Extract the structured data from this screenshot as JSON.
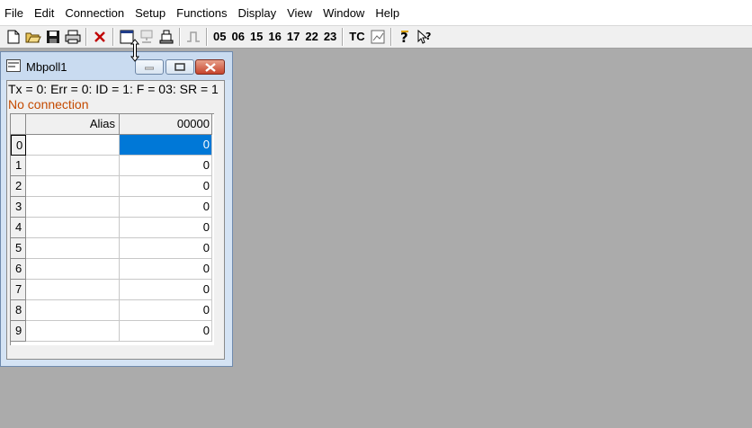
{
  "menu": [
    "File",
    "Edit",
    "Connection",
    "Setup",
    "Functions",
    "Display",
    "View",
    "Window",
    "Help"
  ],
  "toolbar": {
    "function_codes": [
      "05",
      "06",
      "15",
      "16",
      "17",
      "22",
      "23"
    ],
    "tc_label": "TC"
  },
  "window": {
    "title": "Mbpoll1",
    "status_line": "Tx = 0: Err = 0: ID = 1: F = 03: SR = 1",
    "connection_status": "No connection",
    "columns": {
      "alias": "Alias",
      "value": "00000"
    },
    "rows": [
      {
        "index": "0",
        "alias": "",
        "value": "0"
      },
      {
        "index": "1",
        "alias": "",
        "value": "0"
      },
      {
        "index": "2",
        "alias": "",
        "value": "0"
      },
      {
        "index": "3",
        "alias": "",
        "value": "0"
      },
      {
        "index": "4",
        "alias": "",
        "value": "0"
      },
      {
        "index": "5",
        "alias": "",
        "value": "0"
      },
      {
        "index": "6",
        "alias": "",
        "value": "0"
      },
      {
        "index": "7",
        "alias": "",
        "value": "0"
      },
      {
        "index": "8",
        "alias": "",
        "value": "0"
      },
      {
        "index": "9",
        "alias": "",
        "value": "0"
      }
    ]
  },
  "colors": {
    "selection": "#0078d7",
    "no_connection": "#c44a00",
    "workspace": "#ababab"
  }
}
